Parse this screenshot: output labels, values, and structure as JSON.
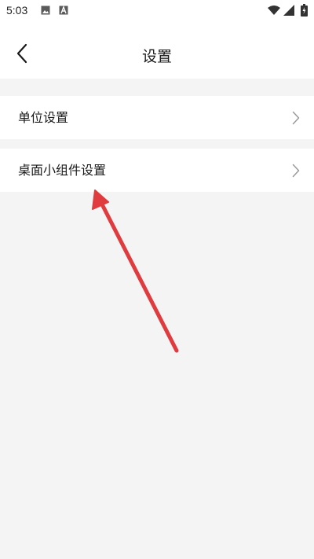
{
  "status_bar": {
    "time": "5:03",
    "icons": [
      "image-icon",
      "a-letter-icon",
      "wifi-icon",
      "signal-icon",
      "battery-icon"
    ]
  },
  "header": {
    "title": "设置",
    "back_icon": "chevron-left-icon"
  },
  "settings": {
    "items": [
      {
        "label": "单位设置",
        "icon": "chevron-right-icon"
      },
      {
        "label": "桌面小组件设置",
        "icon": "chevron-right-icon"
      }
    ]
  },
  "annotation": {
    "arrow_color": "#e03b3e"
  },
  "colors": {
    "background": "#f4f4f4",
    "surface": "#ffffff",
    "text": "#1a1a1a",
    "chevron": "#9a9a9a"
  }
}
